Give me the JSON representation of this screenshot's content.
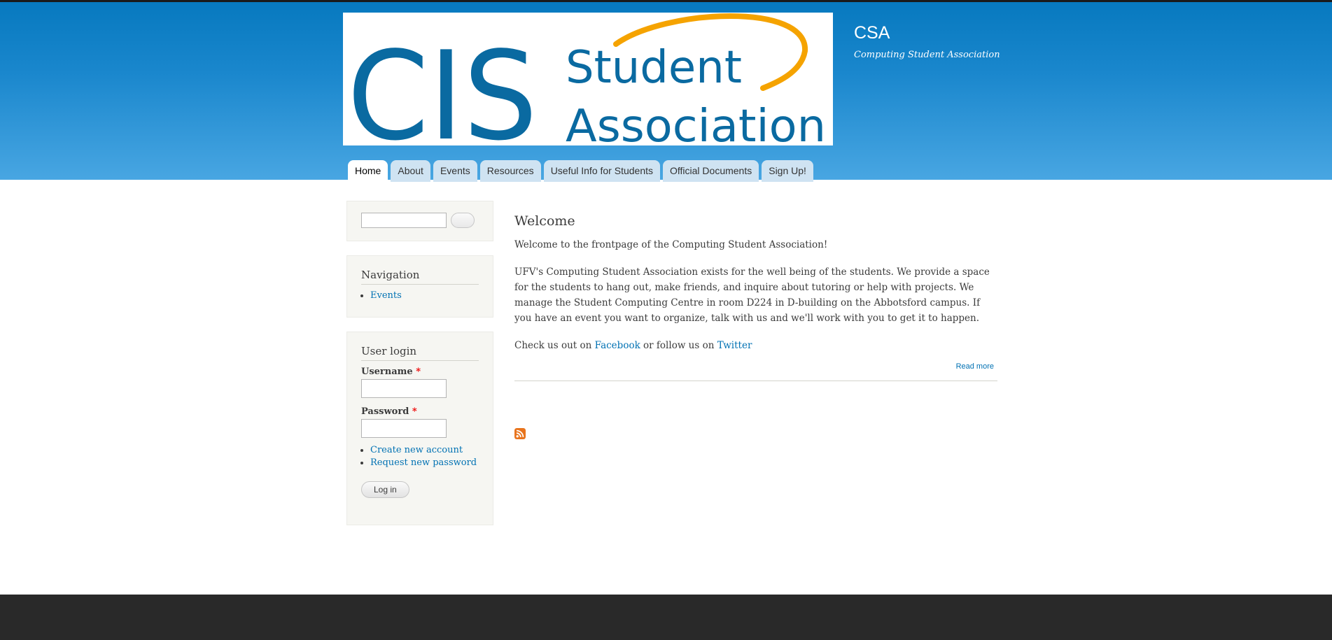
{
  "header": {
    "logo": {
      "cis": "CIS",
      "line1": "Student",
      "line2": "Association"
    },
    "site_name": "CSA",
    "slogan": "Computing Student Association"
  },
  "main_menu": [
    {
      "label": "Home",
      "active": true
    },
    {
      "label": "About"
    },
    {
      "label": "Events"
    },
    {
      "label": "Resources"
    },
    {
      "label": "Useful Info for Students"
    },
    {
      "label": "Official Documents"
    },
    {
      "label": "Sign Up!"
    }
  ],
  "sidebar": {
    "search": {
      "value": "",
      "button_label": ""
    },
    "navigation": {
      "title": "Navigation",
      "items": [
        "Events"
      ]
    },
    "user_login": {
      "title": "User login",
      "username_label": "Username",
      "password_label": "Password",
      "required_marker": "*",
      "links": [
        "Create new account",
        "Request new password"
      ],
      "button_label": "Log in"
    }
  },
  "content": {
    "title": "Welcome",
    "p1": "Welcome to the frontpage of the Computing Student Association!",
    "p2": "UFV's Computing Student Association exists for the well being of the students. We provide a space for the students to hang out, make friends, and inquire about tutoring or help with projects. We manage the Student Computing Centre in room D224 in D-building on the Abbotsford campus. If you have an event you want to organize, talk with us and we'll work with you to get it to happen.",
    "p3_prefix": "Check us out on ",
    "p3_link1": "Facebook",
    "p3_middle": " or follow us on ",
    "p3_link2": "Twitter",
    "read_more": "Read more"
  },
  "icons": {
    "feed": "rss-feed-icon"
  },
  "colors": {
    "header_top": "#0779bf",
    "header_bottom": "#48a6e2",
    "logo_blue": "#0a6aa1",
    "logo_arc": "#f5a300",
    "link": "#0071b3",
    "footer": "#292929",
    "sidebar_bg": "#f6f6f2"
  }
}
